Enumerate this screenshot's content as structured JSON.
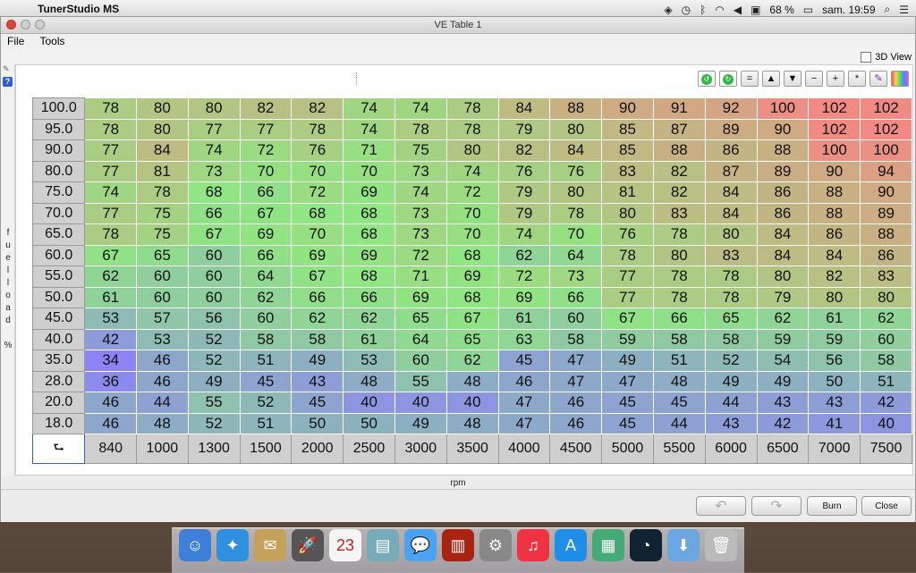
{
  "menubar": {
    "app_name": "TunerStudio MS",
    "battery": "68 %",
    "clock": "sam. 19:59"
  },
  "window": {
    "title": "VE Table 1",
    "menus": [
      "File",
      "Tools"
    ],
    "view3d_label": "3D View"
  },
  "toolbar": {
    "buttons": [
      "=",
      "▲",
      "▼",
      "−",
      "+",
      "*"
    ]
  },
  "table": {
    "y_axis_label": [
      "f",
      "u",
      "e",
      "l",
      "l",
      "o",
      "a",
      "d",
      "",
      "%"
    ],
    "x_axis_label": "rpm",
    "corner_glyph": "⮑",
    "rows_y": [
      "100.0",
      "95.0",
      "90.0",
      "80.0",
      "75.0",
      "70.0",
      "65.0",
      "60.0",
      "55.0",
      "50.0",
      "45.0",
      "40.0",
      "35.0",
      "28.0",
      "20.0",
      "18.0"
    ],
    "cols_x": [
      "840",
      "1000",
      "1300",
      "1500",
      "2000",
      "2500",
      "3000",
      "3500",
      "4000",
      "4500",
      "5000",
      "5500",
      "6000",
      "6500",
      "7000",
      "7500"
    ],
    "values": [
      [
        78,
        80,
        80,
        82,
        82,
        74,
        74,
        78,
        84,
        88,
        90,
        91,
        92,
        100,
        102,
        102
      ],
      [
        78,
        80,
        77,
        77,
        78,
        74,
        78,
        78,
        79,
        80,
        85,
        87,
        89,
        90,
        102,
        102
      ],
      [
        77,
        84,
        74,
        72,
        76,
        71,
        75,
        80,
        82,
        84,
        85,
        88,
        86,
        88,
        100,
        100
      ],
      [
        77,
        81,
        73,
        70,
        70,
        70,
        73,
        74,
        76,
        76,
        83,
        82,
        87,
        89,
        90,
        94
      ],
      [
        74,
        78,
        68,
        66,
        72,
        69,
        74,
        72,
        79,
        80,
        81,
        82,
        84,
        86,
        88,
        90
      ],
      [
        77,
        75,
        66,
        67,
        68,
        68,
        73,
        70,
        79,
        78,
        80,
        83,
        84,
        86,
        88,
        89
      ],
      [
        78,
        75,
        67,
        69,
        70,
        68,
        73,
        70,
        74,
        70,
        76,
        78,
        80,
        84,
        86,
        88
      ],
      [
        67,
        65,
        60,
        66,
        69,
        69,
        72,
        68,
        62,
        64,
        78,
        80,
        83,
        84,
        84,
        86
      ],
      [
        62,
        60,
        60,
        64,
        67,
        68,
        71,
        69,
        72,
        73,
        77,
        78,
        78,
        80,
        82,
        83
      ],
      [
        61,
        60,
        60,
        62,
        66,
        66,
        69,
        68,
        69,
        66,
        77,
        78,
        78,
        79,
        80,
        80
      ],
      [
        53,
        57,
        56,
        60,
        62,
        62,
        65,
        67,
        61,
        60,
        67,
        66,
        65,
        62,
        61,
        62
      ],
      [
        42,
        53,
        52,
        58,
        58,
        61,
        64,
        65,
        63,
        58,
        59,
        58,
        58,
        59,
        59,
        60
      ],
      [
        34,
        46,
        52,
        51,
        49,
        53,
        60,
        62,
        45,
        47,
        49,
        51,
        52,
        54,
        56,
        58
      ],
      [
        36,
        46,
        49,
        45,
        43,
        48,
        55,
        48,
        46,
        47,
        47,
        48,
        49,
        49,
        50,
        51
      ],
      [
        46,
        44,
        55,
        52,
        45,
        40,
        40,
        40,
        47,
        46,
        45,
        45,
        44,
        43,
        43,
        42
      ],
      [
        46,
        48,
        52,
        51,
        50,
        50,
        49,
        48,
        47,
        46,
        45,
        44,
        43,
        42,
        41,
        40
      ]
    ]
  },
  "bottom": {
    "burn_label": "Burn",
    "close_label": "Close"
  },
  "colors": {
    "low": "#8c84f5",
    "mid": "#8fe682",
    "high": "#f28a84"
  }
}
